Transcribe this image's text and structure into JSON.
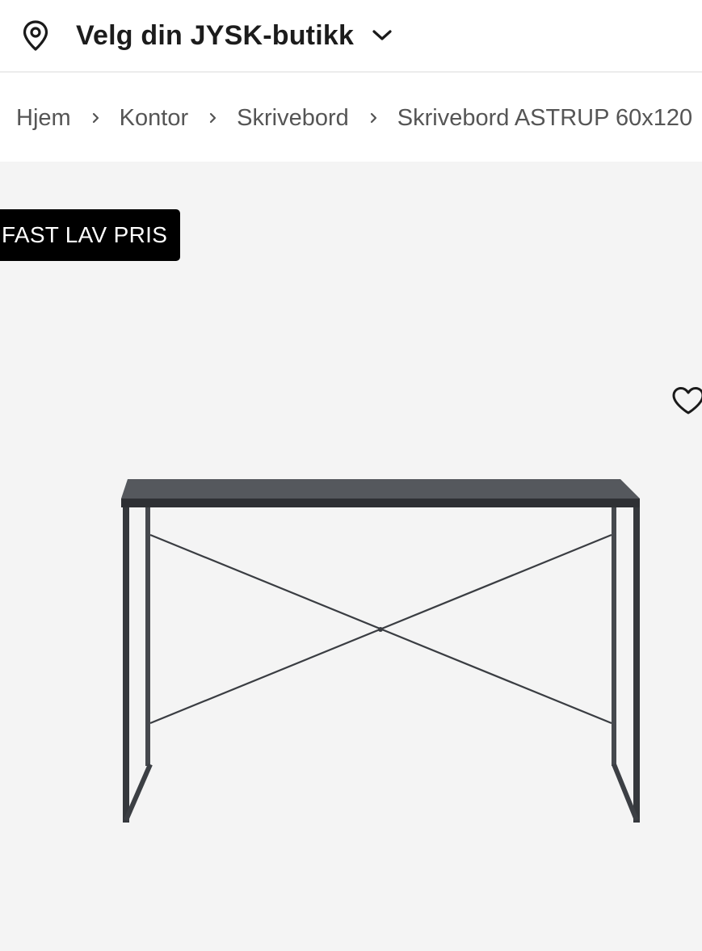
{
  "store_selector": {
    "label": "Velg din JYSK-butikk",
    "pin_icon": "location-pin-icon",
    "chevron_icon": "chevron-down-icon"
  },
  "breadcrumb": {
    "items": [
      "Hjem",
      "Kontor",
      "Skrivebord",
      "Skrivebord ASTRUP 60x120"
    ],
    "separator_icon": "chevron-right-icon"
  },
  "product": {
    "badge": "FAST LAV PRIS",
    "wishlist_icon": "heart-outline-icon",
    "image": "desk-product-image"
  },
  "colors": {
    "badge_bg": "#000000",
    "image_bg": "#f4f4f4",
    "desk_frame": "#3a3d42"
  }
}
